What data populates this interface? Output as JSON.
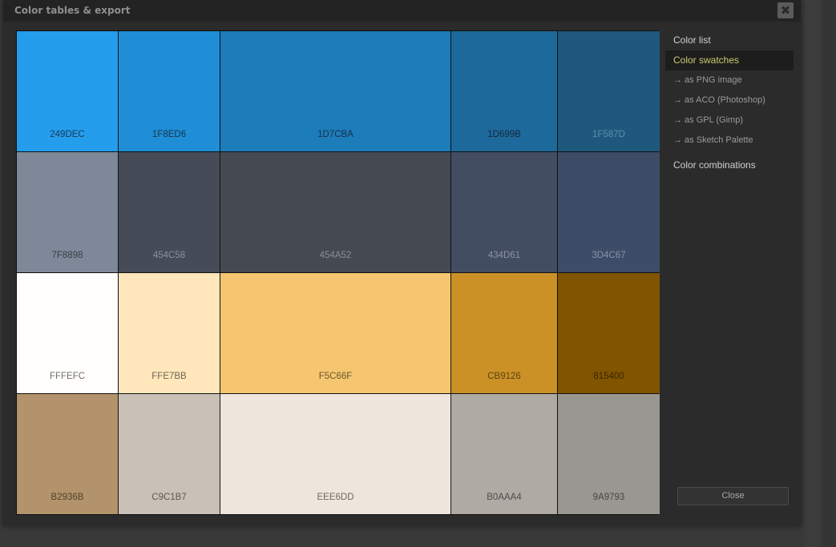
{
  "dialog": {
    "title": "Color tables & export",
    "close_icon": "close-x-icon",
    "close_button_label": "Close"
  },
  "sidebar": {
    "color_list": "Color list",
    "color_swatches": "Color swatches",
    "exports": [
      "→ as PNG image",
      "→ as ACO (Photoshop)",
      "→ as GPL (Gimp)",
      "→ as Sketch Palette"
    ],
    "color_combinations": "Color combinations",
    "active_color": "#c7ce6f"
  },
  "swatches": [
    {
      "hex": "#249DEC",
      "label": "249DEC",
      "text_color": "#1a3a55"
    },
    {
      "hex": "#1F8ED6",
      "label": "1F8ED6",
      "text_color": "#183450"
    },
    {
      "hex": "#1D7CBA",
      "label": "1D7CBA",
      "text_color": "#17314a"
    },
    {
      "hex": "#1D699B",
      "label": "1D699B",
      "text_color": "#16293e"
    },
    {
      "hex": "#1F587D",
      "label": "1F587D",
      "text_color": "#5b8fb0"
    },
    {
      "hex": "#7F8898",
      "label": "7F8898",
      "text_color": "#3a3f48"
    },
    {
      "hex": "#454C58",
      "label": "454C58",
      "text_color": "#8a909a"
    },
    {
      "hex": "#454A52",
      "label": "454A52",
      "text_color": "#8a8e94"
    },
    {
      "hex": "#434D61",
      "label": "434D61",
      "text_color": "#8a93a3"
    },
    {
      "hex": "#3D4C67",
      "label": "3D4C67",
      "text_color": "#8894aa"
    },
    {
      "hex": "#FFFEFC",
      "label": "FFFEFC",
      "text_color": "#707070"
    },
    {
      "hex": "#FFE7BB",
      "label": "FFE7BB",
      "text_color": "#6f6552"
    },
    {
      "hex": "#F5C66F",
      "label": "F5C66F",
      "text_color": "#6b5630"
    },
    {
      "hex": "#CB9126",
      "label": "CB9126",
      "text_color": "#5c4211"
    },
    {
      "hex": "#815400",
      "label": "815400",
      "text_color": "#3a2600"
    },
    {
      "hex": "#B2936B",
      "label": "B2936B",
      "text_color": "#52432f"
    },
    {
      "hex": "#C9C1B7",
      "label": "C9C1B7",
      "text_color": "#5c5852"
    },
    {
      "hex": "#EEE6DD",
      "label": "EEE6DD",
      "text_color": "#6c6863"
    },
    {
      "hex": "#B0AAA4",
      "label": "B0AAA4",
      "text_color": "#504d4a"
    },
    {
      "hex": "#9A9793",
      "label": "9A9793",
      "text_color": "#464542"
    }
  ]
}
